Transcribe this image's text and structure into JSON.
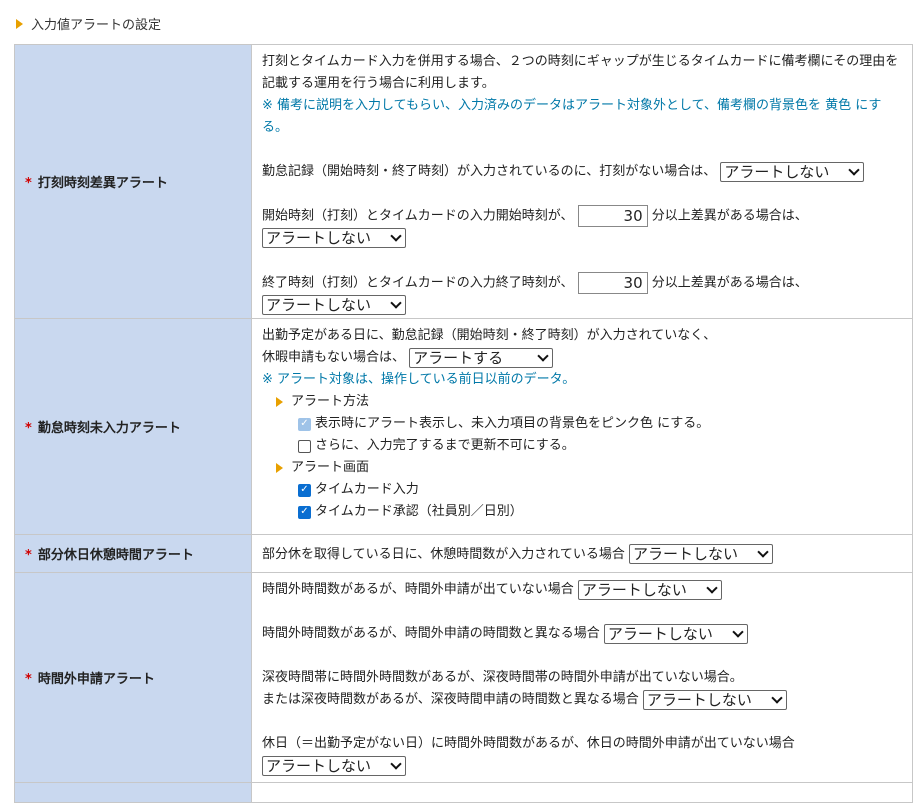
{
  "section": {
    "title": "入力値アラートの設定"
  },
  "rows": {
    "r1": {
      "label": "打刻時刻差異アラート",
      "desc1": "打刻とタイムカード入力を併用する場合、２つの時刻にギャップが生じるタイムカードに備考欄にその理由を記載する運用を行う場合に利用します。",
      "note": "※ 備考に説明を入力してもらい、入力済みのデータはアラート対象外として、備考欄の背景色を 黄色 にする。",
      "line1": "勤怠記録（開始時刻・終了時刻）が入力されているのに、打刻がない場合は、",
      "sel1": "アラートしない",
      "line2": "開始時刻（打刻）とタイムカードの入力開始時刻が、",
      "val2": "30",
      "line2b": "分以上差異がある場合は、",
      "sel2": "アラートしない",
      "line3": "終了時刻（打刻）とタイムカードの入力終了時刻が、",
      "val3": "30",
      "line3b": "分以上差異がある場合は、",
      "sel3": "アラートしない"
    },
    "r2": {
      "label": "勤怠時刻未入力アラート",
      "line1": "出勤予定がある日に、勤怠記録（開始時刻・終了時刻）が入力されていなく、",
      "line2": "休暇申請もない場合は、",
      "sel": "アラートする",
      "note": "※ アラート対象は、操作している前日以前のデータ。",
      "method": "アラート方法",
      "cb1": "表示時にアラート表示し、未入力項目の背景色をピンク色 にする。",
      "cb2": "さらに、入力完了するまで更新不可にする。",
      "screen": "アラート画面",
      "cb3": "タイムカード入力",
      "cb4": "タイムカード承認（社員別／日別）"
    },
    "r3": {
      "label": "部分休日休憩時間アラート",
      "line": "部分休を取得している日に、休憩時間数が入力されている場合",
      "sel": "アラートしない"
    },
    "r4": {
      "label": "時間外申請アラート",
      "line1": "時間外時間数があるが、時間外申請が出ていない場合",
      "sel1": "アラートしない",
      "line2": "時間外時間数があるが、時間外申請の時間数と異なる場合",
      "sel2": "アラートしない",
      "line3": "深夜時間帯に時間外時間数があるが、深夜時間帯の時間外申請が出ていない場合。",
      "line3b": "または深夜時間数があるが、深夜時間申請の時間数と異なる場合",
      "sel3": "アラートしない",
      "line4": "休日（＝出勤予定がない日）に時間外時間数があるが、休日の時間外申請が出ていない場合",
      "sel4": "アラートしない"
    }
  }
}
